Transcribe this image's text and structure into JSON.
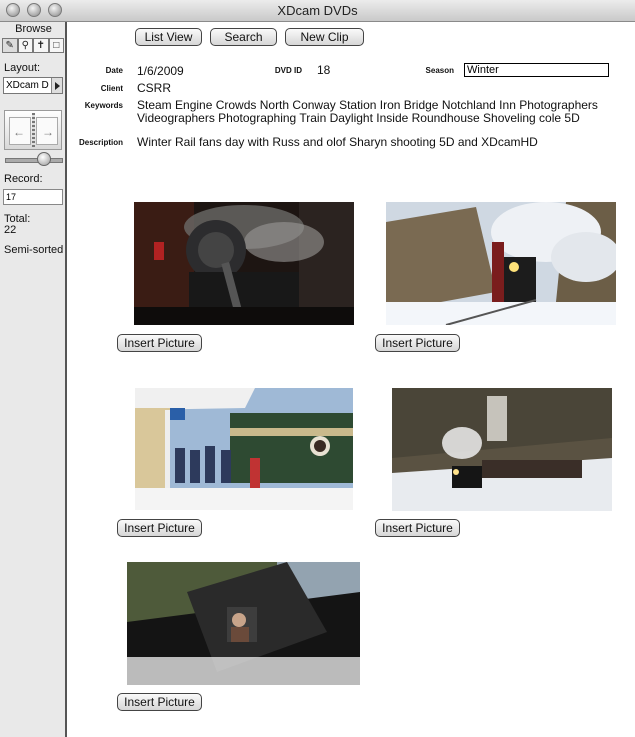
{
  "window": {
    "title": "XDcam DVDs"
  },
  "sidebar": {
    "mode": "Browse",
    "layout_label": "Layout:",
    "layout_value": "XDcam D",
    "record_label": "Record:",
    "record_value": "17",
    "total_label": "Total:",
    "total_value": "22",
    "sort_status": "Semi-sorted"
  },
  "toolbar": {
    "list_view": "List View",
    "search": "Search",
    "new_clip": "New Clip"
  },
  "fields": {
    "date_label": "Date",
    "date_value": "1/6/2009",
    "dvdid_label": "DVD ID",
    "dvdid_value": "18",
    "season_label": "Season",
    "season_value": "Winter",
    "client_label": "Client",
    "client_value": "CSRR",
    "keywords_label": "Keywords",
    "keywords_line1": "Steam Engine  Crowds North Conway Station Iron Bridge Notchland Inn Photographers",
    "keywords_line2": "Videographers Photographing Train Daylight Inside Roundhouse Shoveling cole 5D",
    "description_label": "Description",
    "description_value": "Winter Rail fans day with Russ and olof Sharyn shooting 5D and XDcamHD"
  },
  "pictures": {
    "insert_label": "Insert Picture"
  },
  "colors": {
    "sidebar_bg": "#e9e9e9",
    "button_bg": "#d6d6d6"
  }
}
